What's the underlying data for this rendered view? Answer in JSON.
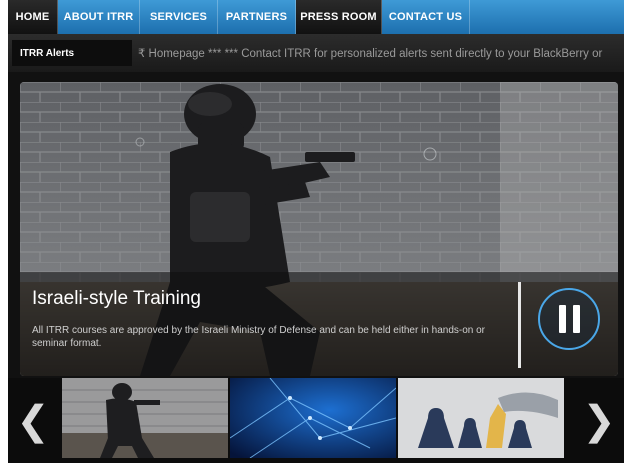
{
  "nav": {
    "items": [
      {
        "label": "HOME"
      },
      {
        "label": "ABOUT ITRR"
      },
      {
        "label": "SERVICES"
      },
      {
        "label": "PARTNERS"
      },
      {
        "label": "PRESS ROOM"
      },
      {
        "label": "CONTACT US"
      }
    ]
  },
  "ticker": {
    "label": "ITRR Alerts",
    "text": "₹ Homepage ***  *** Contact ITRR for personalized alerts sent directly to your BlackBerry or"
  },
  "slide": {
    "title": "Israeli-style Training",
    "description": "All ITRR courses are approved by the Israeli Ministry of Defense and can be held either in hands-on or seminar format.",
    "pause_icon": "pause-icon"
  },
  "carousel": {
    "prev_glyph": "❮",
    "next_glyph": "❯",
    "thumbnails": [
      "training-thumbnail",
      "network-thumbnail",
      "chess-thumbnail"
    ]
  },
  "colors": {
    "nav_blue": "#2b84c6",
    "accent_ring": "#4aa7e8"
  }
}
